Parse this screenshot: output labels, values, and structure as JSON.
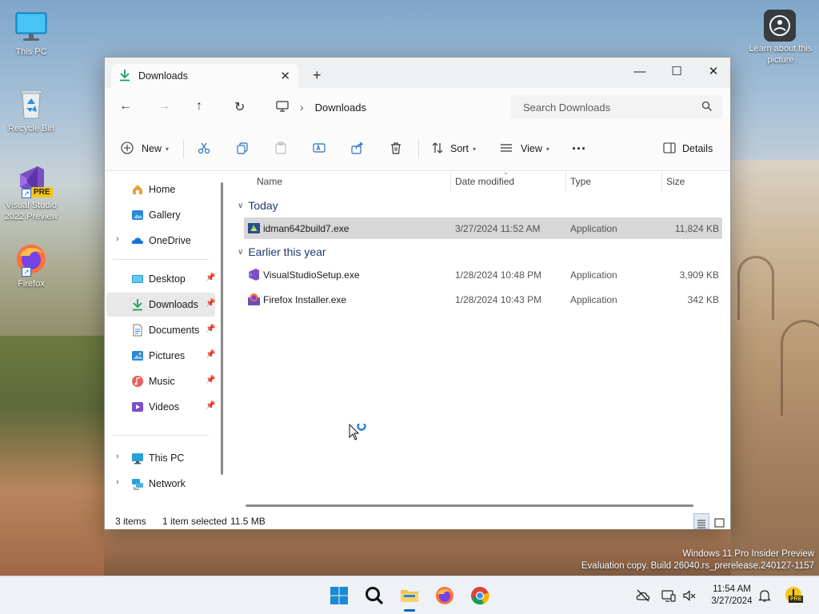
{
  "desktop": {
    "icons": [
      {
        "label": "This PC"
      },
      {
        "label": "Recycle Bin"
      },
      {
        "label": "Visual Studio 2022 Preview",
        "badge": "PRE"
      },
      {
        "label": "Firefox"
      }
    ],
    "learn_label": "Learn about this picture"
  },
  "window": {
    "tab_title": "Downloads",
    "address_current": "Downloads",
    "search_placeholder": "Search Downloads",
    "toolbar": {
      "new_label": "New",
      "sort_label": "Sort",
      "view_label": "View",
      "more_label": "···",
      "details_label": "Details"
    },
    "nav": {
      "items": [
        {
          "label": "Home"
        },
        {
          "label": "Gallery"
        },
        {
          "label": "OneDrive"
        },
        {
          "label": "Desktop"
        },
        {
          "label": "Downloads"
        },
        {
          "label": "Documents"
        },
        {
          "label": "Pictures"
        },
        {
          "label": "Music"
        },
        {
          "label": "Videos"
        },
        {
          "label": "This PC"
        },
        {
          "label": "Network"
        }
      ]
    },
    "columns": {
      "name": "Name",
      "date": "Date modified",
      "type": "Type",
      "size": "Size"
    },
    "groups": [
      {
        "label": "Today",
        "files": [
          {
            "name": "idman642build7.exe",
            "date": "3/27/2024 11:52 AM",
            "type": "Application",
            "size": "11,824 KB"
          }
        ]
      },
      {
        "label": "Earlier this year",
        "files": [
          {
            "name": "VisualStudioSetup.exe",
            "date": "1/28/2024 10:48 PM",
            "type": "Application",
            "size": "3,909 KB"
          },
          {
            "name": "Firefox Installer.exe",
            "date": "1/28/2024 10:43 PM",
            "type": "Application",
            "size": "342 KB"
          }
        ]
      }
    ],
    "status": {
      "items": "3 items",
      "selected": "1 item selected",
      "size": "11.5 MB"
    }
  },
  "watermark": {
    "line1": "Windows 11 Pro Insider Preview",
    "line2": "Evaluation copy. Build 26040.rs_prerelease.240127-1157"
  },
  "taskbar": {
    "time": "11:54 AM",
    "date": "3/27/2024",
    "pre_badge": "PRE"
  },
  "colors": {
    "accent": "#0067c0",
    "folder_yellow": "#f2c14e",
    "download_green": "#1e9e5a"
  }
}
